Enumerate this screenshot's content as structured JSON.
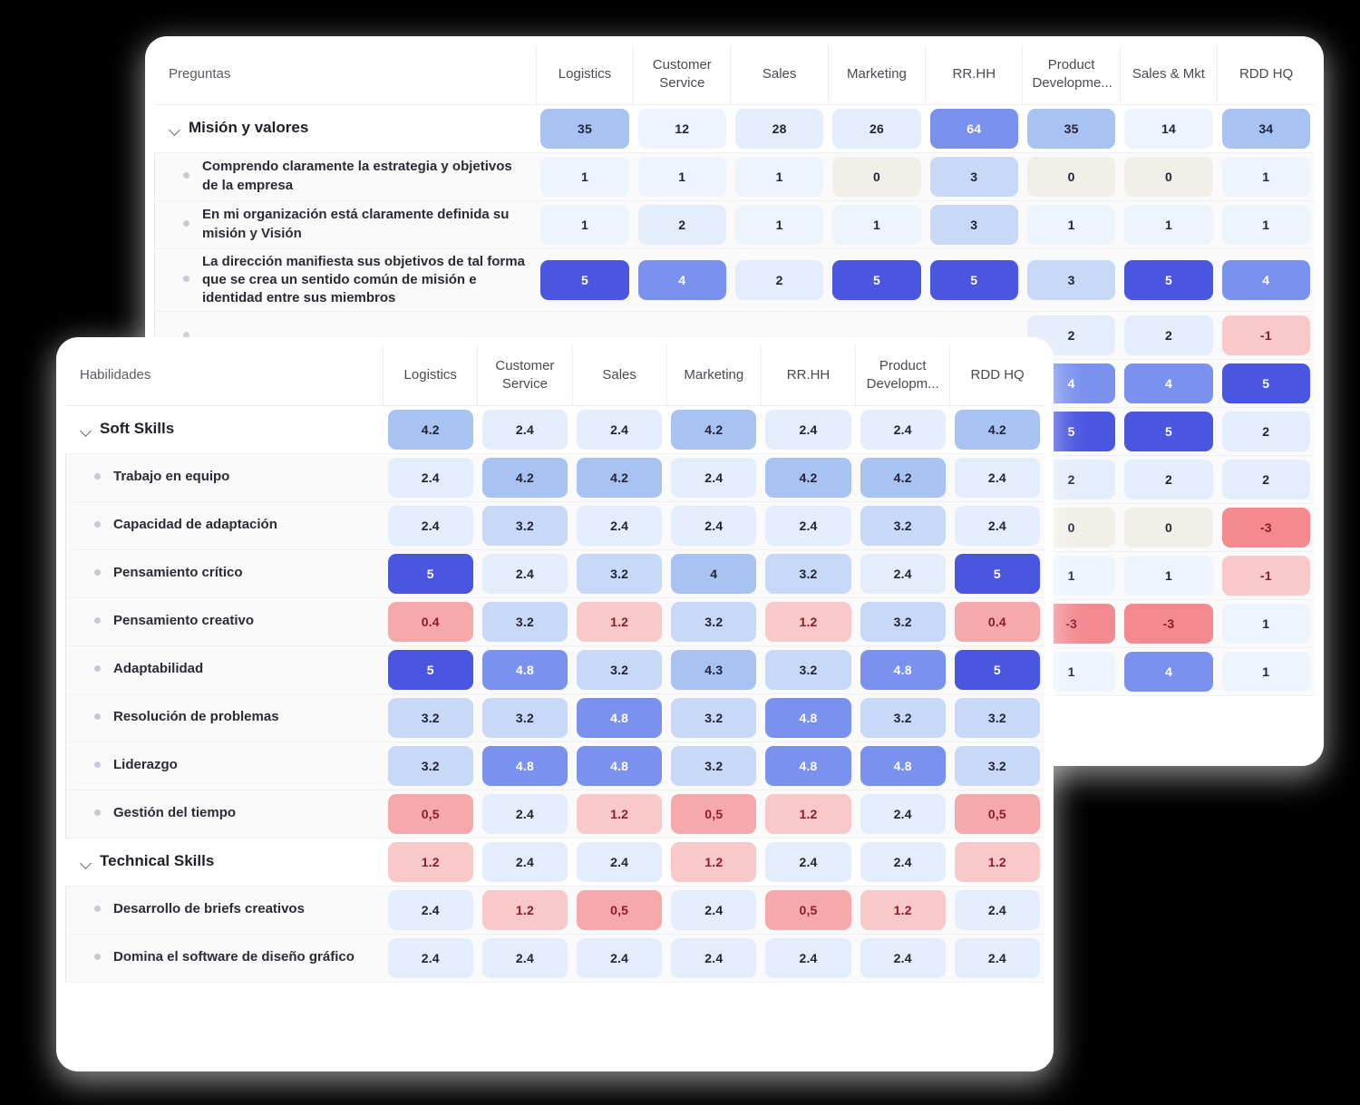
{
  "back_table": {
    "name": "Preguntas heatmap",
    "columns": [
      "Preguntas",
      "Logistics",
      "Customer Service",
      "Sales",
      "Marketing",
      "RR.HH",
      "Product Developme...",
      "Sales & Mkt",
      "RDD HQ"
    ],
    "rows": [
      {
        "label": "Misión y valores",
        "type": "group",
        "icon": "chevron-down-icon",
        "values": [
          "35",
          "12",
          "28",
          "26",
          "64",
          "35",
          "14",
          "34"
        ]
      },
      {
        "label": "Comprendo claramente la estrategia y objetivos de la empresa",
        "type": "item",
        "icon": "bullet-icon",
        "values": [
          "1",
          "1",
          "1",
          "0",
          "3",
          "0",
          "0",
          "1"
        ]
      },
      {
        "label": "En mi organización está claramente definida su misión y Visión",
        "type": "item",
        "icon": "bullet-icon",
        "values": [
          "1",
          "2",
          "1",
          "1",
          "3",
          "1",
          "1",
          "1"
        ]
      },
      {
        "label": "La dirección manifiesta sus objetivos de tal forma que se crea un sentido común de misión e identidad entre sus miembros",
        "type": "item",
        "icon": "bullet-icon",
        "values": [
          "5",
          "4",
          "2",
          "5",
          "5",
          "3",
          "5",
          "4"
        ]
      },
      {
        "label": "",
        "type": "item",
        "icon": "bullet-icon",
        "values": [
          "",
          "",
          "",
          "",
          "",
          "2",
          "2",
          "-1"
        ]
      },
      {
        "label": "",
        "type": "item",
        "icon": "bullet-icon",
        "values": [
          "",
          "",
          "",
          "",
          "",
          "4",
          "4",
          "5"
        ]
      },
      {
        "label": "",
        "type": "item",
        "icon": "bullet-icon",
        "values": [
          "",
          "",
          "",
          "",
          "",
          "5",
          "5",
          "2"
        ]
      },
      {
        "label": "",
        "type": "item",
        "icon": "bullet-icon",
        "values": [
          "",
          "",
          "",
          "",
          "",
          "2",
          "2",
          "2"
        ]
      },
      {
        "label": "",
        "type": "item",
        "icon": "bullet-icon",
        "values": [
          "",
          "",
          "",
          "",
          "",
          "0",
          "0",
          "-3"
        ]
      },
      {
        "label": "",
        "type": "item",
        "icon": "bullet-icon",
        "values": [
          "",
          "",
          "",
          "",
          "",
          "1",
          "1",
          "-1"
        ]
      },
      {
        "label": "",
        "type": "item",
        "icon": "bullet-icon",
        "values": [
          "",
          "",
          "",
          "",
          "",
          "-3",
          "-3",
          "1"
        ]
      },
      {
        "label": "",
        "type": "item",
        "icon": "bullet-icon",
        "values": [
          "",
          "",
          "",
          "",
          "",
          "1",
          "4",
          "1"
        ]
      }
    ]
  },
  "front_table": {
    "name": "Habilidades heatmap",
    "columns": [
      "Habilidades",
      "Logistics",
      "Customer Service",
      "Sales",
      "Marketing",
      "RR.HH",
      "Product Developm...",
      "RDD HQ"
    ],
    "rows": [
      {
        "label": "Soft Skills",
        "type": "group",
        "icon": "chevron-down-icon",
        "values": [
          "4.2",
          "2.4",
          "2.4",
          "4.2",
          "2.4",
          "2.4",
          "4.2"
        ]
      },
      {
        "label": "Trabajo en equipo",
        "type": "item",
        "icon": "bullet-icon",
        "values": [
          "2.4",
          "4.2",
          "4.2",
          "2.4",
          "4.2",
          "4.2",
          "2.4"
        ]
      },
      {
        "label": "Capacidad de adaptación",
        "type": "item",
        "icon": "bullet-icon",
        "values": [
          "2.4",
          "3.2",
          "2.4",
          "2.4",
          "2.4",
          "3.2",
          "2.4"
        ]
      },
      {
        "label": "Pensamiento crítico",
        "type": "item",
        "icon": "bullet-icon",
        "values": [
          "5",
          "2.4",
          "3.2",
          "4",
          "3.2",
          "2.4",
          "5"
        ]
      },
      {
        "label": "Pensamiento creativo",
        "type": "item",
        "icon": "bullet-icon",
        "values": [
          "0.4",
          "3.2",
          "1.2",
          "3.2",
          "1.2",
          "3.2",
          "0.4"
        ]
      },
      {
        "label": "Adaptabilidad",
        "type": "item",
        "icon": "bullet-icon",
        "values": [
          "5",
          "4.8",
          "3.2",
          "4.3",
          "3.2",
          "4.8",
          "5"
        ]
      },
      {
        "label": "Resolución de problemas",
        "type": "item",
        "icon": "bullet-icon",
        "values": [
          "3.2",
          "3.2",
          "4.8",
          "3.2",
          "4.8",
          "3.2",
          "3.2"
        ]
      },
      {
        "label": "Liderazgo",
        "type": "item",
        "icon": "bullet-icon",
        "values": [
          "3.2",
          "4.8",
          "4.8",
          "3.2",
          "4.8",
          "4.8",
          "3.2"
        ]
      },
      {
        "label": "Gestión del tiempo",
        "type": "item",
        "icon": "bullet-icon",
        "values": [
          "0,5",
          "2.4",
          "1.2",
          "0,5",
          "1.2",
          "2.4",
          "0,5"
        ]
      },
      {
        "label": "Technical Skills",
        "type": "group",
        "icon": "chevron-down-icon",
        "values": [
          "1.2",
          "2.4",
          "2.4",
          "1.2",
          "2.4",
          "2.4",
          "1.2"
        ]
      },
      {
        "label": "Desarrollo de briefs creativos",
        "type": "item",
        "icon": "bullet-icon",
        "values": [
          "2.4",
          "1.2",
          "0,5",
          "2.4",
          "0,5",
          "1.2",
          "2.4"
        ]
      },
      {
        "label": "Domina el software de diseño gráfico",
        "type": "item",
        "icon": "bullet-icon",
        "values": [
          "2.4",
          "2.4",
          "2.4",
          "2.4",
          "2.4",
          "2.4",
          "2.4"
        ]
      }
    ]
  },
  "colors": {
    "blue_max": "#4a56e0",
    "blue_strong": "#7b91ee",
    "blue_mid": "#a8c2f2",
    "blue_soft": "#c7d9f7",
    "blue_faint": "#e4edfb",
    "blue_trace": "#eef4fd",
    "neutral": "#f2efe9",
    "red_soft": "#f9c9c9",
    "red_mid": "#f6a9ab",
    "red_strong": "#f28a90",
    "text_light": "#ffffff",
    "text_dark": "#23233a",
    "text_red": "#8c1c2c",
    "card_bg": "#ffffff",
    "page_bg": "#000000"
  }
}
